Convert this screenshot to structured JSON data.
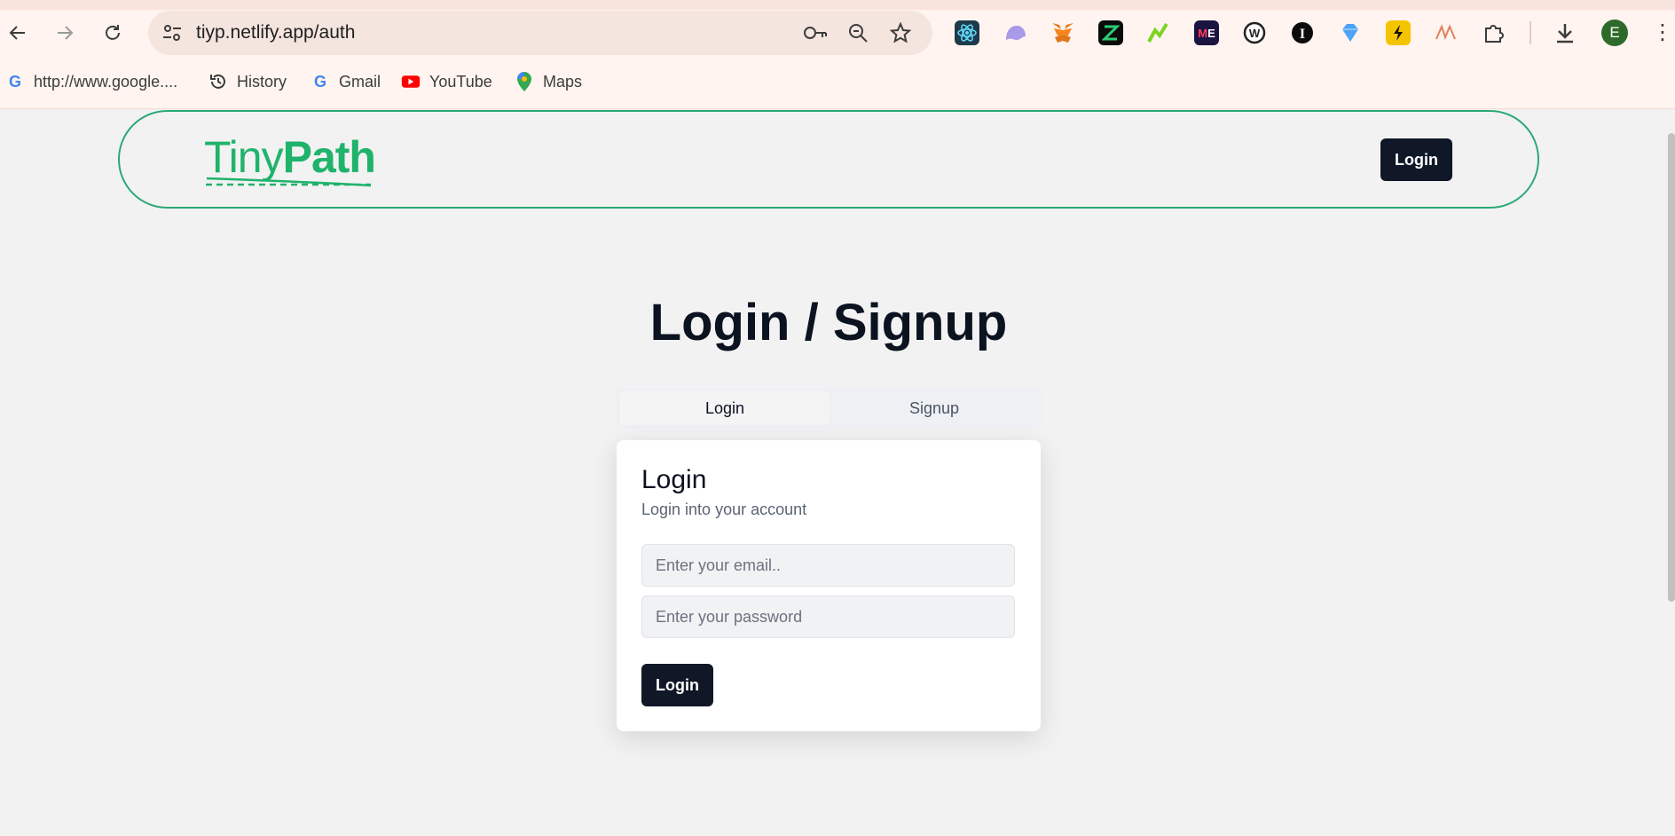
{
  "browser": {
    "url": "tiyp.netlify.app/auth",
    "profile_initial": "E",
    "bookmarks": [
      {
        "label": "http://www.google....",
        "icon": "google-icon"
      },
      {
        "label": "History",
        "icon": "history-icon"
      },
      {
        "label": "Gmail",
        "icon": "google-icon"
      },
      {
        "label": "YouTube",
        "icon": "youtube-icon"
      },
      {
        "label": "Maps",
        "icon": "maps-icon"
      }
    ],
    "extensions": [
      "react-devtools-icon",
      "ghost-icon",
      "metamask-icon",
      "extension-green-icon",
      "chart-extension-icon",
      "mail-extension-icon",
      "wordpress-icon",
      "info-extension-icon",
      "gem-icon",
      "bolt-extension-icon",
      "wave-extension-icon",
      "puzzle-icon"
    ]
  },
  "header": {
    "logo_tiny": "Tiny",
    "logo_path": "Path",
    "login_label": "Login",
    "accent_color": "#1fb36b"
  },
  "main": {
    "title": "Login / Signup",
    "tabs": [
      {
        "label": "Login",
        "active": true
      },
      {
        "label": "Signup",
        "active": false
      }
    ],
    "card": {
      "title": "Login",
      "subtitle": "Login into your account",
      "email_placeholder": "Enter your email..",
      "password_placeholder": "Enter your password",
      "submit_label": "Login"
    }
  }
}
